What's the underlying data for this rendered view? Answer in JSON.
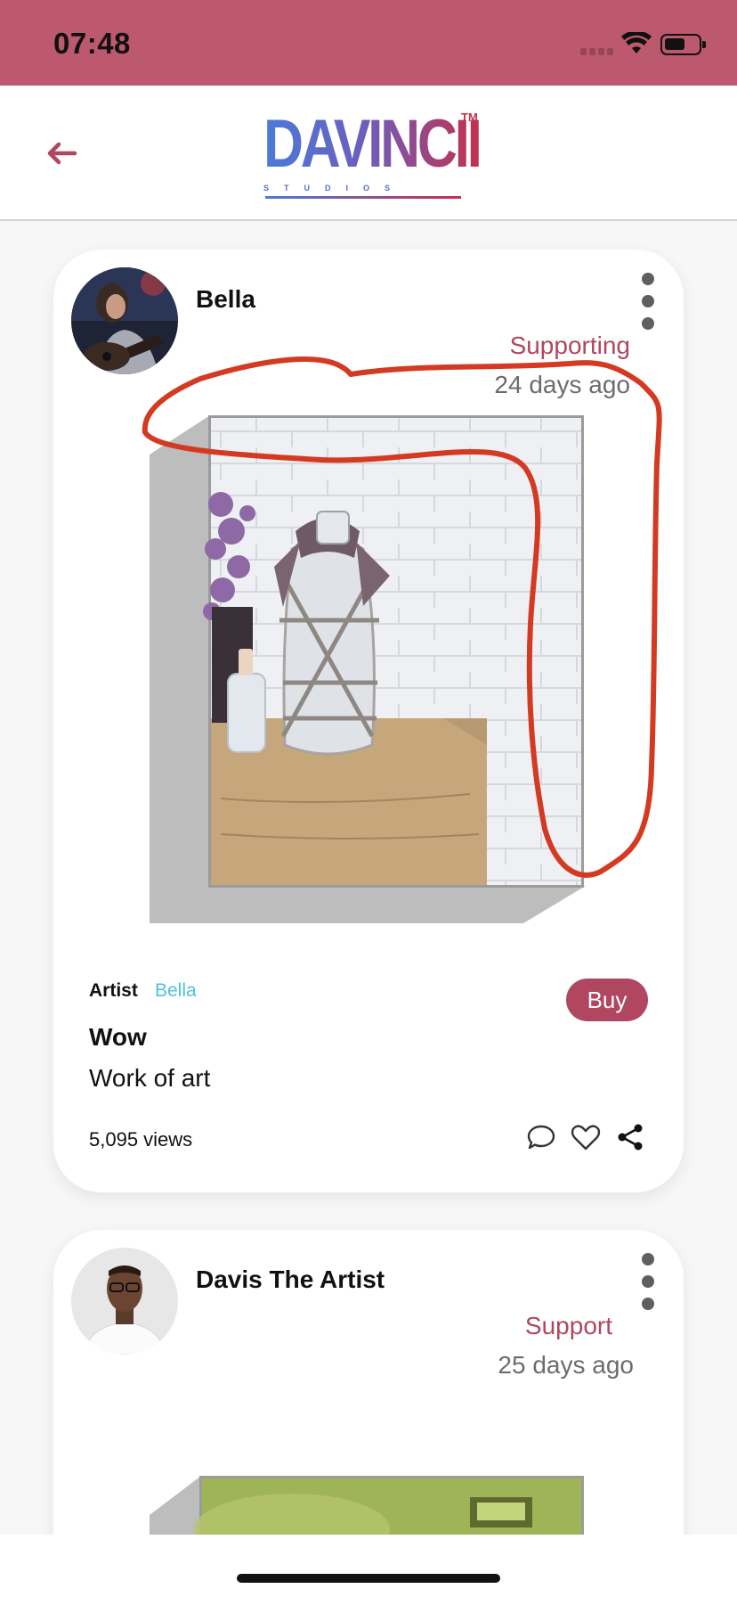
{
  "status_bar": {
    "time": "07:48"
  },
  "header": {
    "back_icon": "arrow-left-icon",
    "logo": {
      "text": "DAVINCII",
      "trademark": "TM",
      "subtitle": "STUDIOS"
    },
    "accent_color": "#b0465f"
  },
  "posts": [
    {
      "author": "Bella",
      "support_label": "Supporting",
      "time_ago": "24 days ago",
      "artist_label": "Artist",
      "artist_name": "Bella",
      "buy_label": "Buy",
      "title": "Wow",
      "description": "Work of art",
      "views": "5,095 views",
      "actions": [
        "comment-icon",
        "heart-icon",
        "share-icon"
      ]
    },
    {
      "author": "Davis The Artist",
      "support_label": "Support",
      "time_ago": "25 days ago"
    }
  ],
  "colors": {
    "status_bar": "#bd596e",
    "accent": "#b0465f",
    "artist_link": "#4fc3d9",
    "annotation_stroke": "#d43a22"
  }
}
